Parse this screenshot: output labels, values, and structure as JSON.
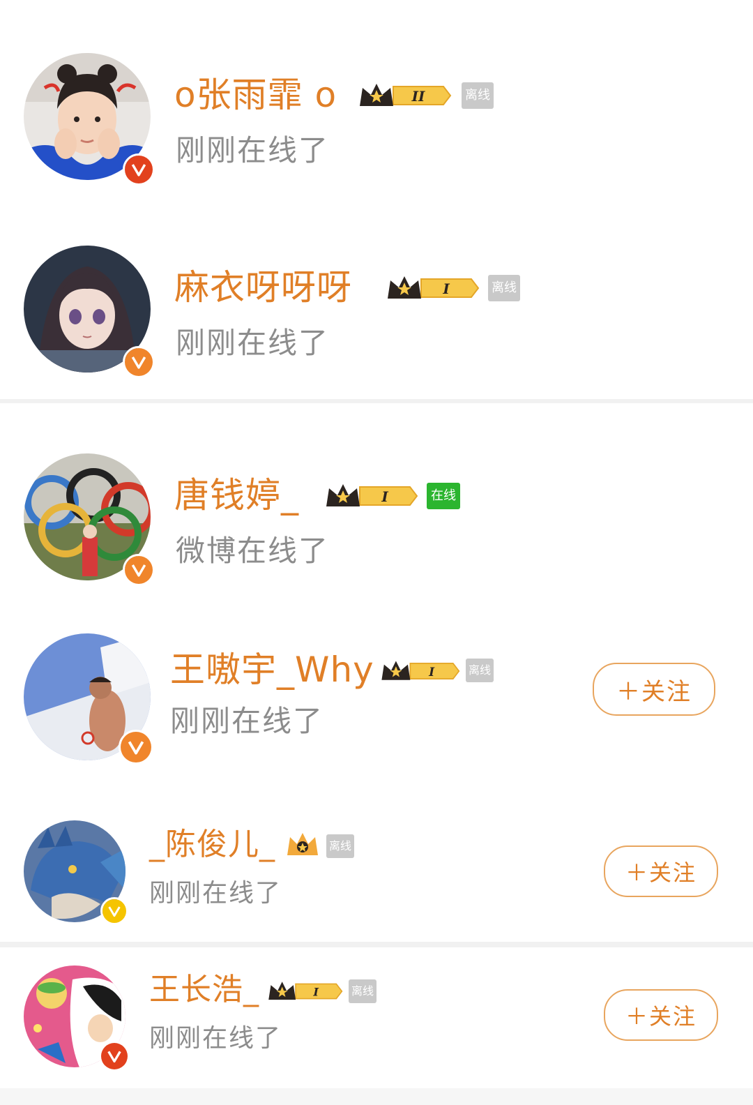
{
  "users": [
    {
      "name": "o张雨霏 o",
      "level": "II",
      "online_tag": "离线",
      "online_color": "#c9c9c9",
      "status": "刚刚在线了",
      "follow": "",
      "vbadge_color": "#e2411d"
    },
    {
      "name": "麻衣呀呀呀",
      "level": "I",
      "online_tag": "离线",
      "online_color": "#c9c9c9",
      "status": "刚刚在线了",
      "follow": "",
      "vbadge_color": "#f0852b"
    },
    {
      "name": "唐钱婷_",
      "level": "I",
      "online_tag": "在线",
      "online_color": "#2bb52f",
      "status": "微博在线了",
      "follow": "",
      "vbadge_color": "#f0852b"
    },
    {
      "name": "王嗷宇_Why",
      "level": "I",
      "online_tag": "离线",
      "online_color": "#c9c9c9",
      "status": "刚刚在线了",
      "follow": "＋关注",
      "vbadge_color": "#f0852b"
    },
    {
      "name": "_陈俊儿_",
      "level": "",
      "online_tag": "离线",
      "online_color": "#c9c9c9",
      "status": "刚刚在线了",
      "follow": "＋关注",
      "vbadge_color": "#f5c400"
    },
    {
      "name": "王长浩_",
      "level": "I",
      "online_tag": "离线",
      "online_color": "#c9c9c9",
      "status": "刚刚在线了",
      "follow": "＋关注",
      "vbadge_color": "#e2411d"
    }
  ],
  "icons": {
    "verified_badge": "verified-v-icon",
    "crown": "crown-level-icon",
    "small_crown": "small-crown-icon"
  }
}
